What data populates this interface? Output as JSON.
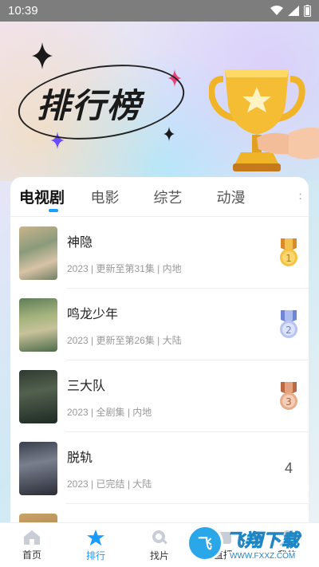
{
  "status_bar": {
    "time": "10:39"
  },
  "hero": {
    "title": "排行榜"
  },
  "tabs": [
    {
      "label": "电视剧",
      "active": true
    },
    {
      "label": "电影",
      "active": false
    },
    {
      "label": "综艺",
      "active": false
    },
    {
      "label": "动漫",
      "active": false
    }
  ],
  "list": [
    {
      "name": "神隐",
      "meta": "2023 | 更新至第31集 | 内地",
      "rank": "1",
      "medal": "gold"
    },
    {
      "name": "鸣龙少年",
      "meta": "2023 | 更新至第26集 | 大陆",
      "rank": "2",
      "medal": "silver"
    },
    {
      "name": "三大队",
      "meta": "2023 | 全剧集 | 内地",
      "rank": "3",
      "medal": "bronze"
    },
    {
      "name": "脱轨",
      "meta": "2023 | 已完结 | 大陆",
      "rank": "4",
      "medal": "none"
    }
  ],
  "bottom_nav": [
    {
      "label": "首页",
      "icon": "home-icon",
      "active": false
    },
    {
      "label": "排行",
      "icon": "star-icon",
      "active": true
    },
    {
      "label": "找片",
      "icon": "search-icon",
      "active": false
    },
    {
      "label": "直播",
      "icon": "tv-icon",
      "active": false
    },
    {
      "label": "我的",
      "icon": "user-icon",
      "active": false
    }
  ],
  "watermark": {
    "logo": "飞",
    "text": "飞翔下载",
    "url": "WWW.FXXZ.COM"
  },
  "colors": {
    "accent": "#1a9bff",
    "gold": "#f0b429",
    "silver": "#8fa4e0",
    "bronze": "#d88b62"
  }
}
